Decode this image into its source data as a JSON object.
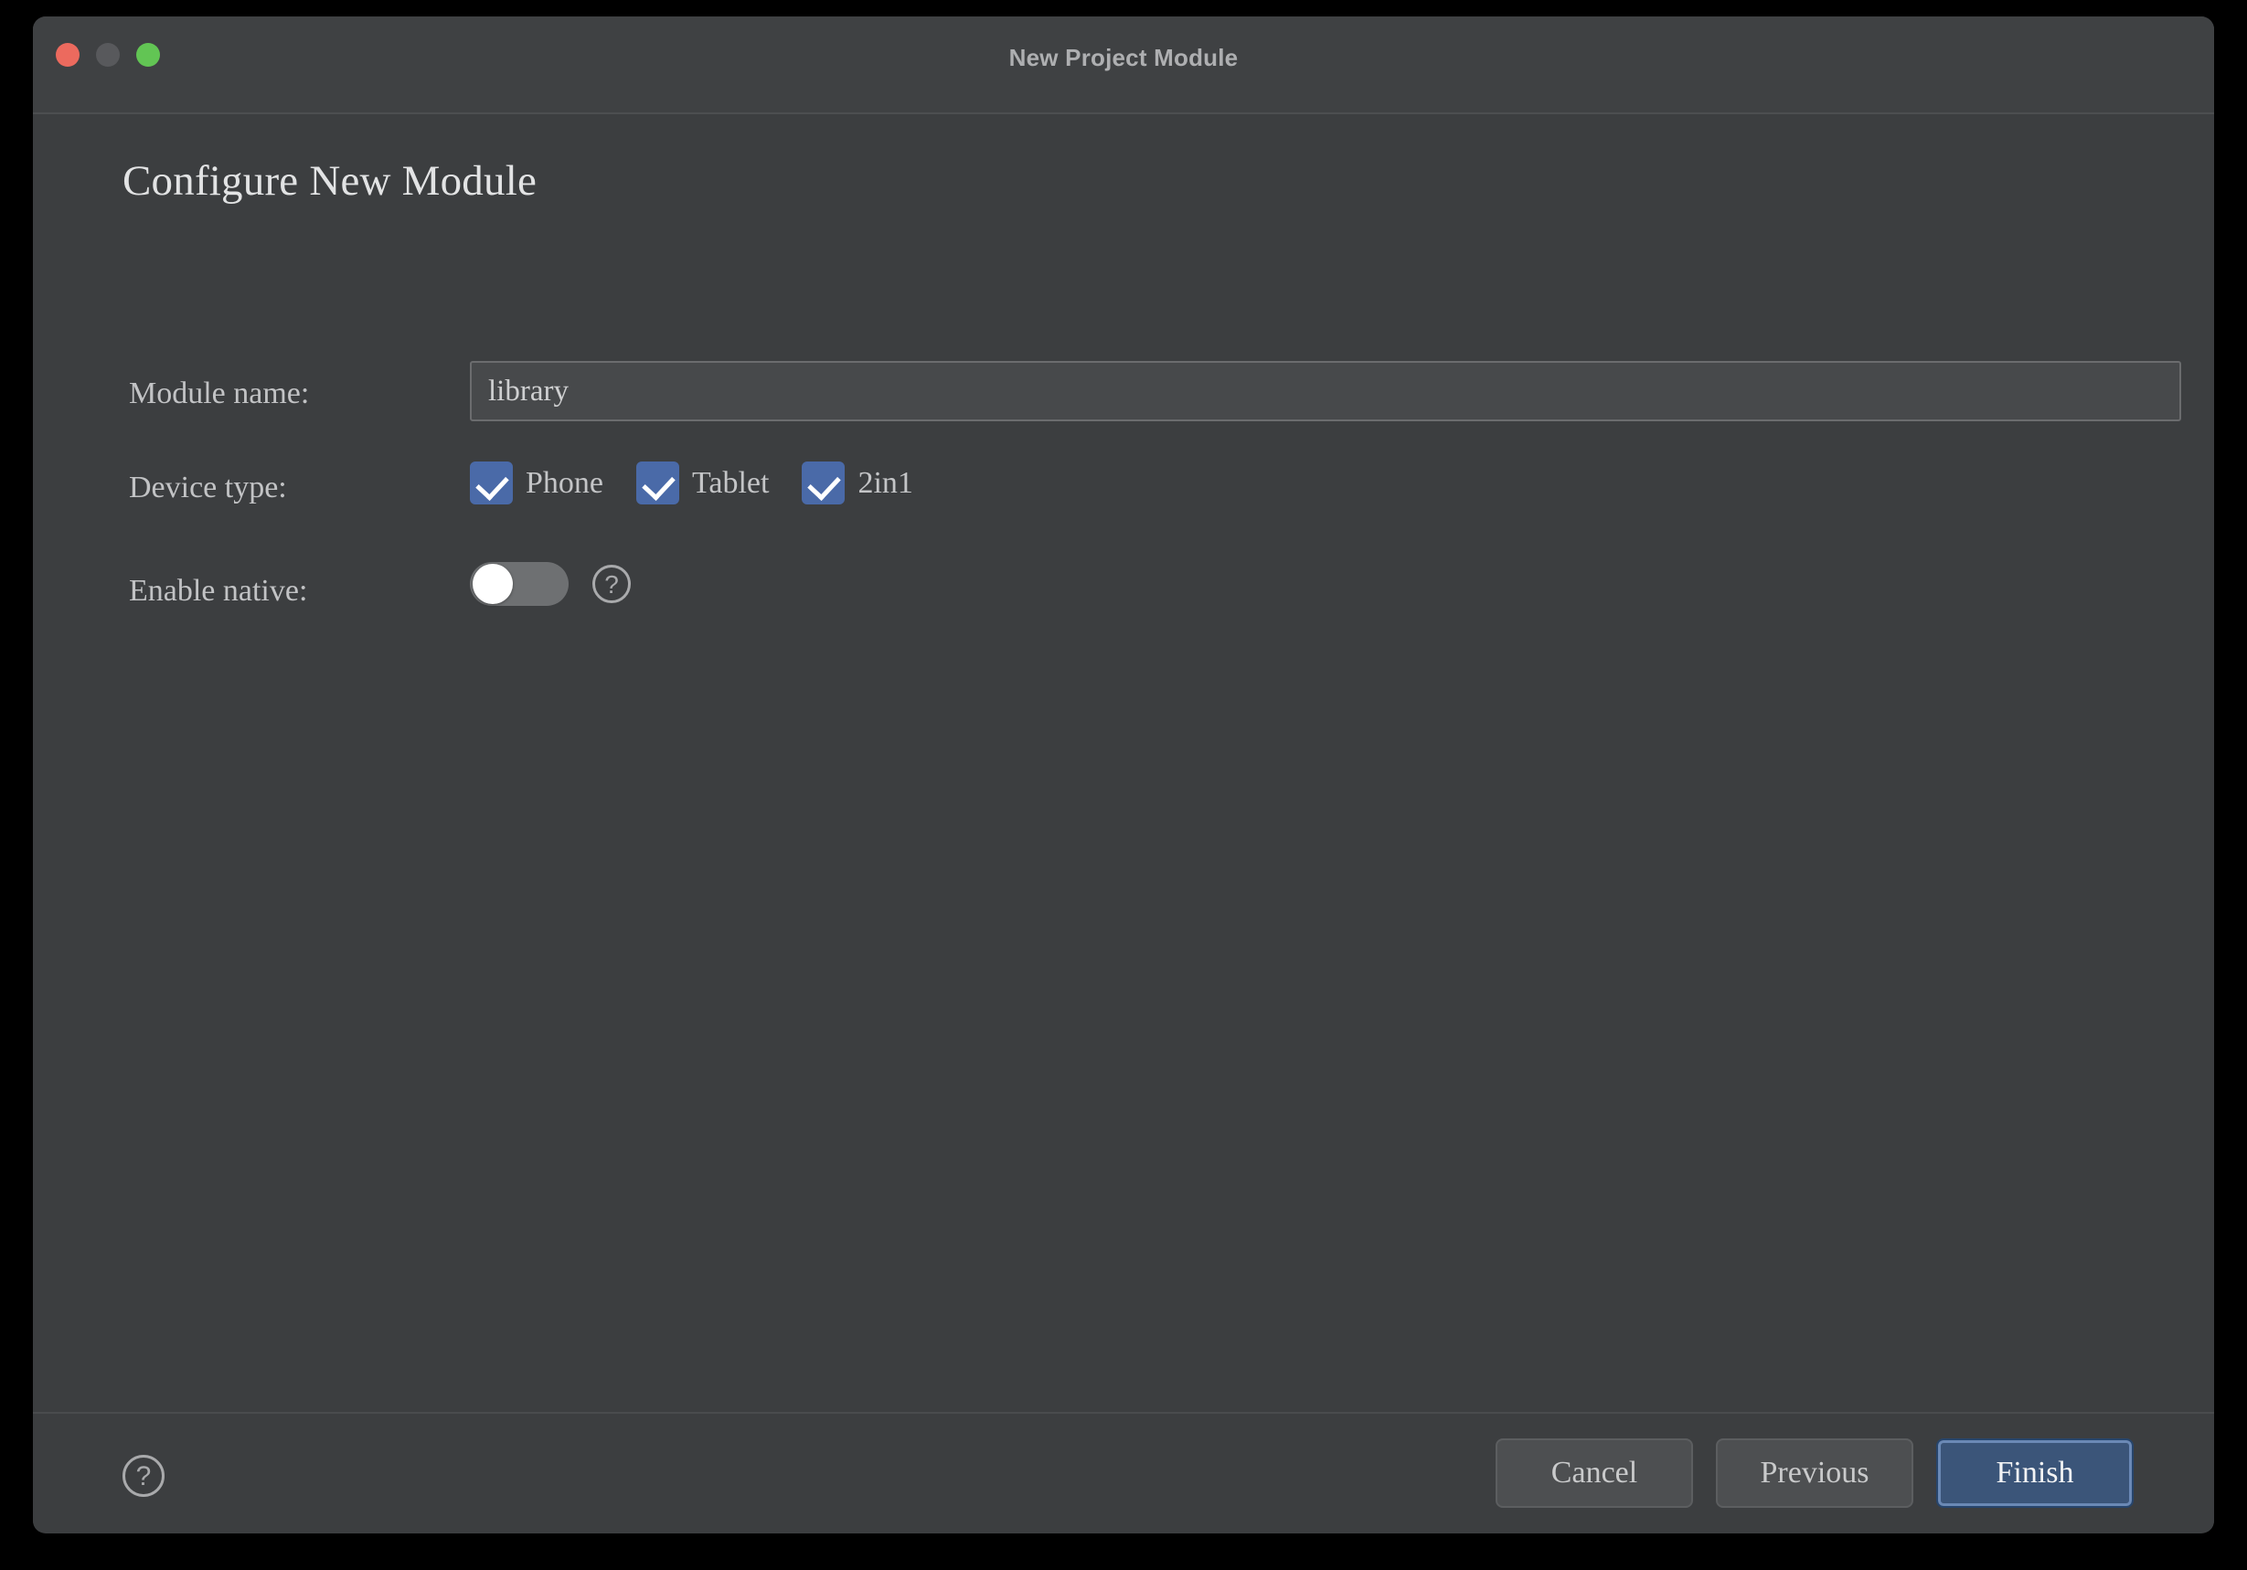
{
  "window": {
    "title": "New Project Module",
    "traffic_lights": [
      {
        "name": "close",
        "color": "#ec6a5e"
      },
      {
        "name": "minimize",
        "color": "#58595c"
      },
      {
        "name": "maximize",
        "color": "#62c554"
      }
    ]
  },
  "page": {
    "heading": "Configure New Module"
  },
  "form": {
    "module_name": {
      "label": "Module name:",
      "value": "library",
      "placeholder": "Module name"
    },
    "device_type": {
      "label": "Device type:",
      "options": [
        {
          "label": "Phone",
          "checked": true
        },
        {
          "label": "Tablet",
          "checked": true
        },
        {
          "label": "2in1",
          "checked": true
        }
      ]
    },
    "enable_native": {
      "label": "Enable native:",
      "enabled": false,
      "help_icon": "question-mark-icon",
      "help_glyph": "?"
    }
  },
  "footer": {
    "help_glyph": "?",
    "buttons": [
      {
        "label": "Cancel",
        "style": "secondary"
      },
      {
        "label": "Previous",
        "style": "secondary"
      },
      {
        "label": "Finish",
        "style": "primary"
      }
    ]
  },
  "colors": {
    "window_bg": "#3c3e40",
    "titlebar_bg": "#3f4143",
    "accent_blue": "#4a6aa8",
    "primary_button": "#3b5579",
    "focus_ring": "#6b89b5",
    "text": "#c4c5c7",
    "heading_text": "#e2e3e4"
  }
}
